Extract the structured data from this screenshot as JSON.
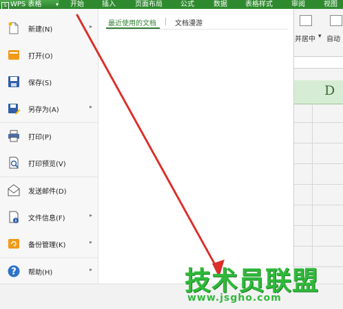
{
  "ribbon": {
    "app_button_logo": "S",
    "app_button_label": "WPS 表格",
    "tabs": [
      "开始",
      "插入",
      "页面布局",
      "公式",
      "数据",
      "表格样式",
      "审阅",
      "视图"
    ]
  },
  "toolbar": {
    "merge_center_label": "并居中",
    "auto_label": "自动"
  },
  "sheet": {
    "column_header": "D"
  },
  "file_menu": {
    "items": [
      {
        "label": "新建(N)",
        "icon": "new-file-icon",
        "has_submenu": true
      },
      {
        "label": "打开(O)",
        "icon": "open-folder-icon",
        "has_submenu": false
      },
      {
        "label": "保存(S)",
        "icon": "save-icon",
        "has_submenu": false
      },
      {
        "label": "另存为(A)",
        "icon": "save-as-icon",
        "has_submenu": true
      },
      {
        "label": "打印(P)",
        "icon": "print-icon",
        "has_submenu": false
      },
      {
        "label": "打印预览(V)",
        "icon": "print-preview-icon",
        "has_submenu": false
      },
      {
        "label": "发送邮件(D)",
        "icon": "email-icon",
        "has_submenu": false
      },
      {
        "label": "文件信息(F)",
        "icon": "file-info-icon",
        "has_submenu": true
      },
      {
        "label": "备份管理(K)",
        "icon": "backup-icon",
        "has_submenu": true
      },
      {
        "label": "帮助(H)",
        "icon": "help-icon",
        "has_submenu": true
      }
    ],
    "tabs": {
      "recent": "最近使用的文档",
      "roaming": "文档漫游"
    }
  },
  "watermark": {
    "title": "技术员联盟",
    "url": "www.jsgho.com"
  },
  "colors": {
    "ribbon_green": "#2f8a2f",
    "accent_green": "#2e7d32",
    "arrow_red": "#d9302a",
    "watermark_green": "#2fb93a"
  }
}
